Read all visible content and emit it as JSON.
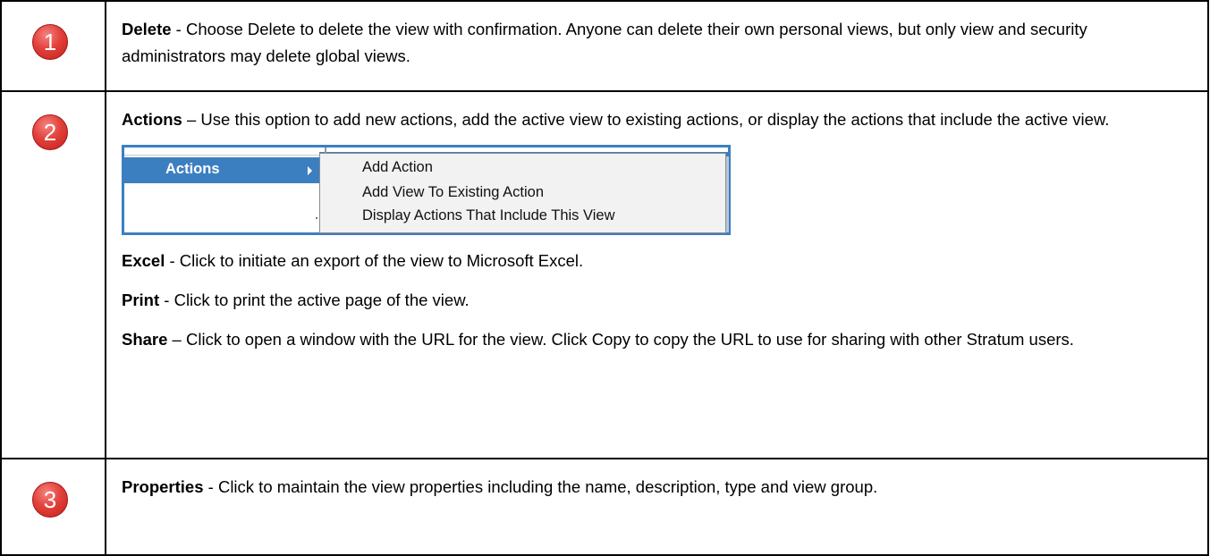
{
  "rows": [
    {
      "number": "1",
      "term": "Delete",
      "text": " - Choose Delete to delete the view with confirmation. Anyone can delete their own personal views, but only view and security administrators may delete global views."
    },
    {
      "number": "2",
      "term": "Actions",
      "text": " – Use this option to add new actions, add the active view to existing actions, or display the actions that include the active view.",
      "menu": {
        "selected_item": "Actions",
        "submenu_items": [
          "Add Action",
          "Add View To Existing Action",
          "Display Actions That Include This View"
        ]
      },
      "extra": [
        {
          "term": "Excel",
          "text": " - Click to initiate an export of the view to Microsoft Excel."
        },
        {
          "term": "Print",
          "text": " - Click to print the active page of the view."
        },
        {
          "term": "Share",
          "text": " – Click to open a window with the URL for the view. Click Copy to copy the URL to use for sharing with other Stratum users."
        }
      ]
    },
    {
      "number": "3",
      "term": "Properties",
      "text": " - Click to maintain the view properties including the name, description, type and view group."
    }
  ],
  "colors": {
    "badge": "#e2413b",
    "menu_highlight": "#3c7fc1"
  }
}
